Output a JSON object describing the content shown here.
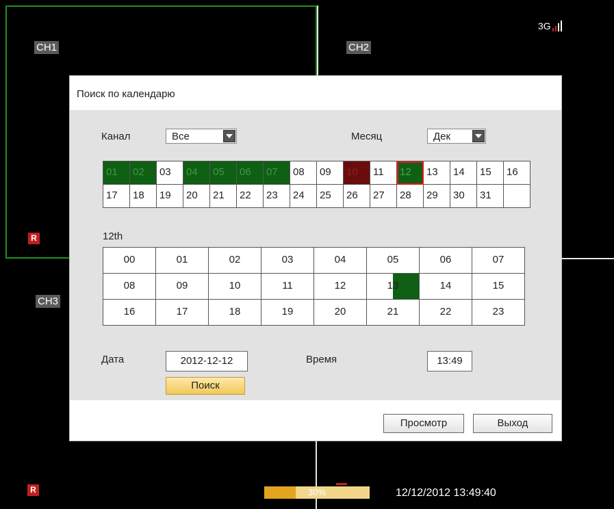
{
  "channels": [
    {
      "label": "CH1"
    },
    {
      "label": "CH2"
    },
    {
      "label": "CH3"
    }
  ],
  "status": {
    "network_label": "3G",
    "record_badge": "R",
    "playback_progress_text": "30%",
    "playback_progress_value": 0.3,
    "datetime": "12/12/2012 13:49:40"
  },
  "dialog": {
    "title": "Поиск по календарю",
    "channel_label": "Канал",
    "channel_value": "Все",
    "month_label": "Месяц",
    "month_value": "Дек",
    "days": [
      {
        "label": "01",
        "state": "rec"
      },
      {
        "label": "02",
        "state": "rec"
      },
      {
        "label": "03",
        "state": "none"
      },
      {
        "label": "04",
        "state": "rec"
      },
      {
        "label": "05",
        "state": "rec"
      },
      {
        "label": "06",
        "state": "rec"
      },
      {
        "label": "07",
        "state": "rec"
      },
      {
        "label": "08",
        "state": "none"
      },
      {
        "label": "09",
        "state": "none"
      },
      {
        "label": "10",
        "state": "alarm"
      },
      {
        "label": "11",
        "state": "none"
      },
      {
        "label": "12",
        "state": "selected"
      },
      {
        "label": "13",
        "state": "none"
      },
      {
        "label": "14",
        "state": "none"
      },
      {
        "label": "15",
        "state": "none"
      },
      {
        "label": "16",
        "state": "none"
      },
      {
        "label": "17",
        "state": "none"
      },
      {
        "label": "18",
        "state": "none"
      },
      {
        "label": "19",
        "state": "none"
      },
      {
        "label": "20",
        "state": "none"
      },
      {
        "label": "21",
        "state": "none"
      },
      {
        "label": "22",
        "state": "none"
      },
      {
        "label": "23",
        "state": "none"
      },
      {
        "label": "24",
        "state": "none"
      },
      {
        "label": "25",
        "state": "none"
      },
      {
        "label": "26",
        "state": "none"
      },
      {
        "label": "27",
        "state": "none"
      },
      {
        "label": "28",
        "state": "none"
      },
      {
        "label": "29",
        "state": "none"
      },
      {
        "label": "30",
        "state": "none"
      },
      {
        "label": "31",
        "state": "none"
      },
      {
        "label": "",
        "state": "blank"
      }
    ],
    "selected_date_heading": "12th",
    "hours": [
      {
        "label": "00",
        "rec": 0
      },
      {
        "label": "01",
        "rec": 0
      },
      {
        "label": "02",
        "rec": 0
      },
      {
        "label": "03",
        "rec": 0
      },
      {
        "label": "04",
        "rec": 0
      },
      {
        "label": "05",
        "rec": 0
      },
      {
        "label": "06",
        "rec": 0
      },
      {
        "label": "07",
        "rec": 0
      },
      {
        "label": "08",
        "rec": 0
      },
      {
        "label": "09",
        "rec": 0
      },
      {
        "label": "10",
        "rec": 0
      },
      {
        "label": "11",
        "rec": 0
      },
      {
        "label": "12",
        "rec": 0
      },
      {
        "label": "13",
        "rec": 0.5
      },
      {
        "label": "14",
        "rec": 0
      },
      {
        "label": "15",
        "rec": 0
      },
      {
        "label": "16",
        "rec": 0
      },
      {
        "label": "17",
        "rec": 0
      },
      {
        "label": "18",
        "rec": 0
      },
      {
        "label": "19",
        "rec": 0
      },
      {
        "label": "20",
        "rec": 0
      },
      {
        "label": "21",
        "rec": 0
      },
      {
        "label": "22",
        "rec": 0
      },
      {
        "label": "23",
        "rec": 0
      }
    ],
    "date_label": "Дата",
    "date_value": "2012-12-12",
    "time_label": "Время",
    "time_value": "13:49",
    "search_button": "Поиск",
    "view_button": "Просмотр",
    "exit_button": "Выход"
  },
  "colors": {
    "recording": "#0f5f14",
    "alarm": "#6b0c0c",
    "selected_border": "#e21b1b",
    "channel_frame": "#1f8f1f",
    "progress": "#e3a420"
  }
}
